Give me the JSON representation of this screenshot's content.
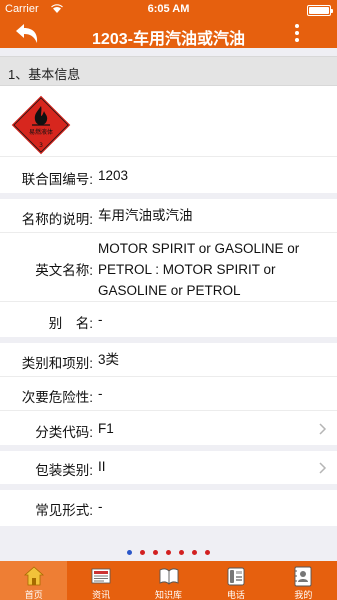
{
  "status": {
    "carrier": "Carrier",
    "time": "6:05 AM"
  },
  "nav": {
    "title": "1203-车用汽油或汽油"
  },
  "section": {
    "title": "1、基本信息"
  },
  "hazard_sign": {
    "label": "易燃液体",
    "class_number": "3",
    "colors": {
      "background": "#d7261e",
      "symbol": "#111111"
    }
  },
  "fields": {
    "un_number": {
      "label": "联合国编号:",
      "value": "1203"
    },
    "name_desc": {
      "label": "名称的说明:",
      "value": "车用汽油或汽油"
    },
    "english_name": {
      "label": "英文名称:",
      "value": "MOTOR SPIRIT or GASOLINE or PETROL : MOTOR SPIRIT or GASOLINE or PETROL"
    },
    "alias": {
      "label": "别　名:",
      "value": "-"
    },
    "class_division": {
      "label": "类别和项别:",
      "value": "3类"
    },
    "secondary_hazard": {
      "label": "次要危险性:",
      "value": "-"
    },
    "class_code": {
      "label": "分类代码:",
      "value": "F1"
    },
    "packing_group": {
      "label": "包装类别:",
      "value": "II"
    },
    "common_form": {
      "label": "常见形式:",
      "value": "-"
    }
  },
  "pager": {
    "count": 7,
    "active_index": 0
  },
  "tabs": [
    {
      "label": "首页",
      "icon": "home-icon"
    },
    {
      "label": "资讯",
      "icon": "news-icon"
    },
    {
      "label": "知识库",
      "icon": "book-icon"
    },
    {
      "label": "电话",
      "icon": "phone-icon"
    },
    {
      "label": "我的",
      "icon": "contact-card-icon"
    }
  ],
  "colors": {
    "brand": "#e6600e",
    "tab_active": "#ee7e34",
    "pager_dot": "#d22020",
    "pager_dot_active": "#2b57c9"
  }
}
